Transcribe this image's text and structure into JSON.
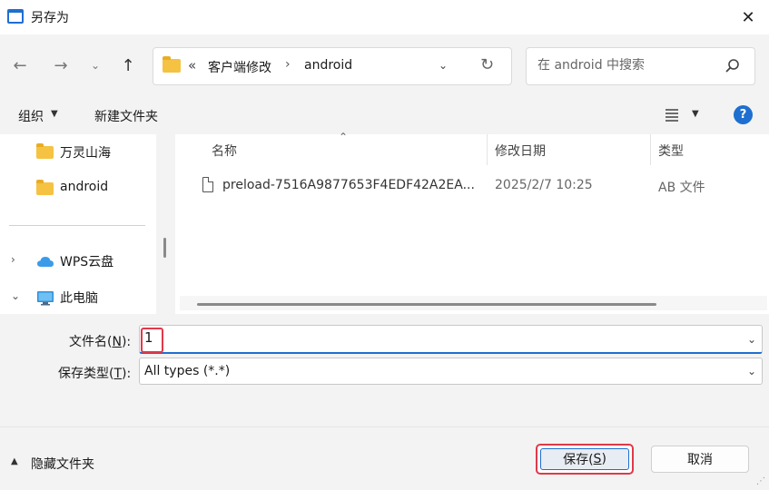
{
  "window": {
    "title": "另存为"
  },
  "nav": {
    "back_icon": "arrow-left-icon",
    "forward_icon": "arrow-right-icon",
    "history_icon": "chevron-down-icon",
    "up_icon": "arrow-up-icon",
    "address": {
      "chevrons": "«",
      "crumbs": [
        "客户端修改",
        "android"
      ],
      "separator": "›"
    },
    "refresh_icon": "refresh-icon",
    "search": {
      "placeholder": "在 android 中搜索"
    }
  },
  "toolbar": {
    "organize": "组织",
    "new_folder": "新建文件夹",
    "help": "?"
  },
  "sidebar": {
    "items": [
      {
        "label": "万灵山海",
        "icon": "folder-icon"
      },
      {
        "label": "android",
        "icon": "folder-icon"
      },
      {
        "label": "WPS云盘",
        "icon": "cloud-icon",
        "caret": "›"
      },
      {
        "label": "此电脑",
        "icon": "computer-icon",
        "caret": "⌄"
      }
    ]
  },
  "filelist": {
    "columns": [
      "名称",
      "修改日期",
      "类型"
    ],
    "rows": [
      {
        "name": "preload-7516A9877653F4EDF42A2EA...",
        "date": "2025/2/7 10:25",
        "type": "AB 文件"
      }
    ]
  },
  "form": {
    "filename_label": "文件名(",
    "filename_key": "N",
    "filename_suffix": "):",
    "filename_value": "1",
    "filetype_label": "保存类型(",
    "filetype_key": "T",
    "filetype_suffix": "):",
    "filetype_value": "All types (*.*)"
  },
  "footer": {
    "hide_folders": "隐藏文件夹",
    "save_label": "保存(",
    "save_key": "S",
    "save_suffix": ")",
    "cancel_label": "取消"
  },
  "colors": {
    "accent": "#1e6fd0",
    "highlight_border": "#e0394a",
    "folder": "#f5c242"
  }
}
